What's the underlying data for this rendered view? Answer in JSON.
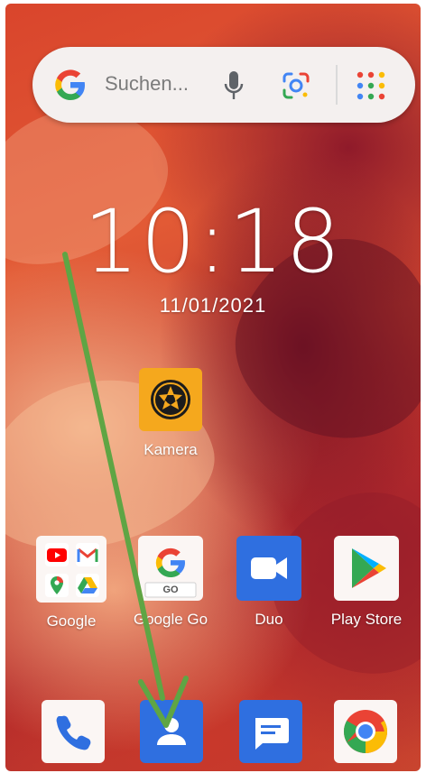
{
  "search": {
    "placeholder": "Suchen..."
  },
  "clock": {
    "time": "10:18",
    "date": "11/01/2021"
  },
  "home_apps": {
    "camera": "Kamera",
    "google_folder": "Google",
    "google_go": "Google Go",
    "duo": "Duo",
    "play_store": "Play Store"
  },
  "google_go_badge": "GO",
  "dock": [
    "phone-icon",
    "contacts-icon",
    "messages-icon",
    "chrome-icon"
  ],
  "colors": {
    "arrow": "#5fa544",
    "blue_icon": "#2f6fe0",
    "camera_bg": "#f5a81d"
  }
}
